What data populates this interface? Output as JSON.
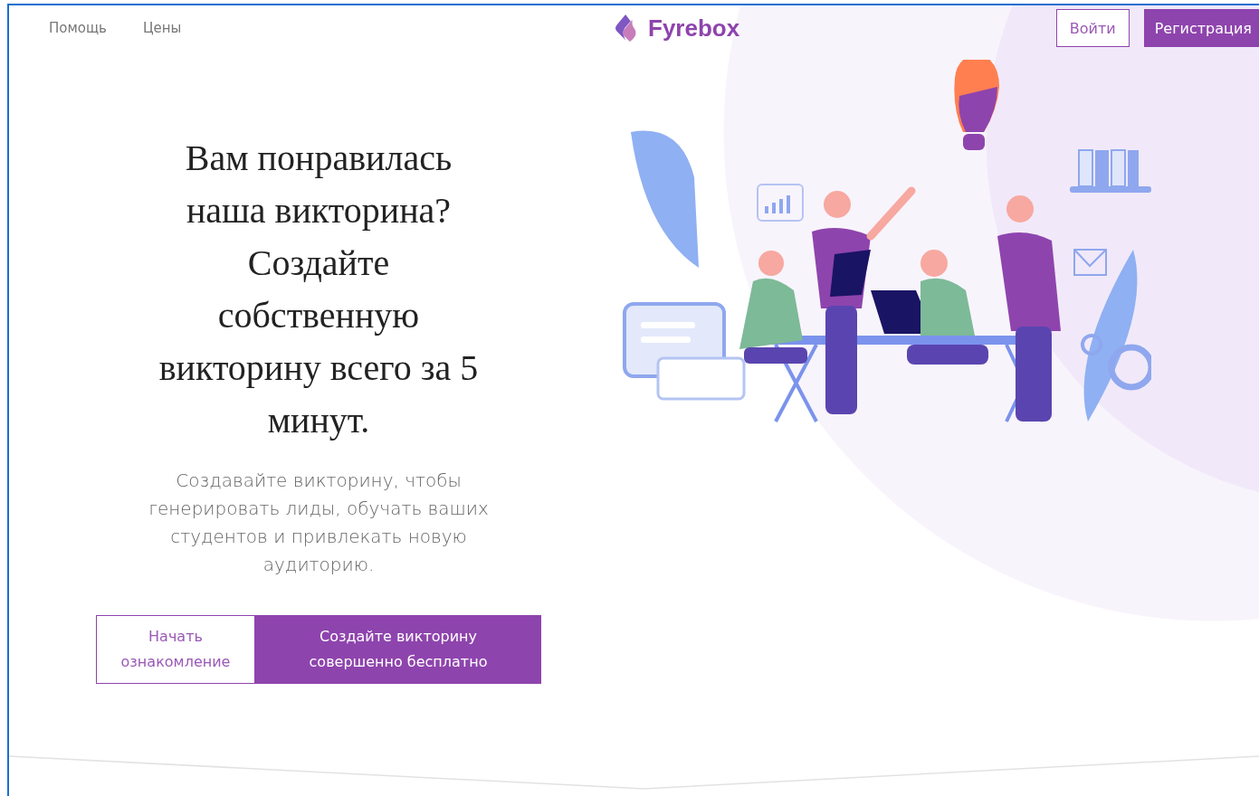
{
  "header": {
    "nav_links": [
      "Помощь",
      "Цены"
    ],
    "logo": "Fyrebox",
    "login_button": "Войти",
    "signup_button": "Регистрация"
  },
  "hero": {
    "heading": "Вам понравилась наша викторина? Создайте собственную викторину всего за 5 минут.",
    "description": "Создавайте викторину, чтобы генерировать лиды, обучать ваших студентов и привлекать новую аудиторию.",
    "buttons": [
      {
        "label": "Начать ознакомление",
        "kind": "outline"
      },
      {
        "label": "Создайте викторину совершенно бесплатно",
        "kind": "primary"
      }
    ]
  }
}
